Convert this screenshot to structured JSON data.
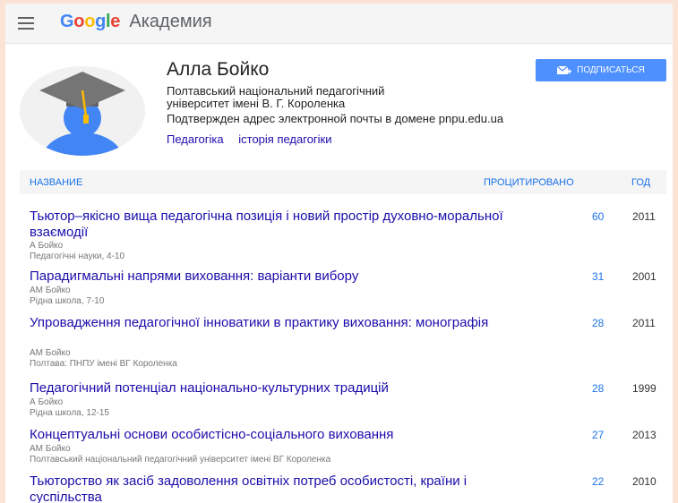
{
  "app": {
    "logo_google": [
      "G",
      "o",
      "o",
      "g",
      "l",
      "e"
    ],
    "product": "Академия"
  },
  "profile": {
    "name": "Алла Бойко",
    "affiliation_line1": "Полтавський національний педагогічний",
    "affiliation_line2": "університет імені В. Г. Короленка",
    "verified": "Подтвержден адрес электронной почты в домене pnpu.edu.ua",
    "interests": [
      "Педагогіка",
      "історія педагогіки"
    ],
    "follow_label": "ПОДПИСАТЬСЯ"
  },
  "table": {
    "headers": {
      "title": "НАЗВАНИЕ",
      "cited": "ПРОЦИТИРОВАНО",
      "year": "ГОД"
    },
    "rows": [
      {
        "title": "Тьютор–якісно вища педагогічна позиція і новий простір духовно-моральної взаємодії",
        "authors": "А Бойко",
        "source": "Педагогічні науки, 4-10",
        "cited": "60",
        "year": "2011"
      },
      {
        "title": "Парадигмальні напрями виховання: варіанти вибору",
        "authors": "АМ Бойко",
        "source": "Рідна школа, 7-10",
        "cited": "31",
        "year": "2001"
      },
      {
        "title": "Упровадження педагогічної інноватики в практику виховання: монографія",
        "authors": "АМ Бойко",
        "source": "Полтава: ПНПУ імені ВГ Короленка",
        "cited": "28",
        "year": "2011"
      },
      {
        "title": "Педагогічний потенціал національно-культурних традицій",
        "authors": "А Бойко",
        "source": "Рідна школа, 12-15",
        "cited": "28",
        "year": "1999"
      },
      {
        "title": "Концептуальні основи особистісно-соціального виховання",
        "authors": "АМ Бойко",
        "source": "Полтавський національний педагогічний університет імені ВГ Короленка",
        "cited": "27",
        "year": "2013"
      },
      {
        "title": "Тьюторство як засіб задоволення освітніх потреб особистості, країни і суспільства",
        "authors": "",
        "source": "",
        "cited": "22",
        "year": "2010"
      }
    ]
  },
  "colors": {
    "link": "#1a0dab",
    "accent": "#4d90fe",
    "header_blue": "#1a73e8"
  }
}
